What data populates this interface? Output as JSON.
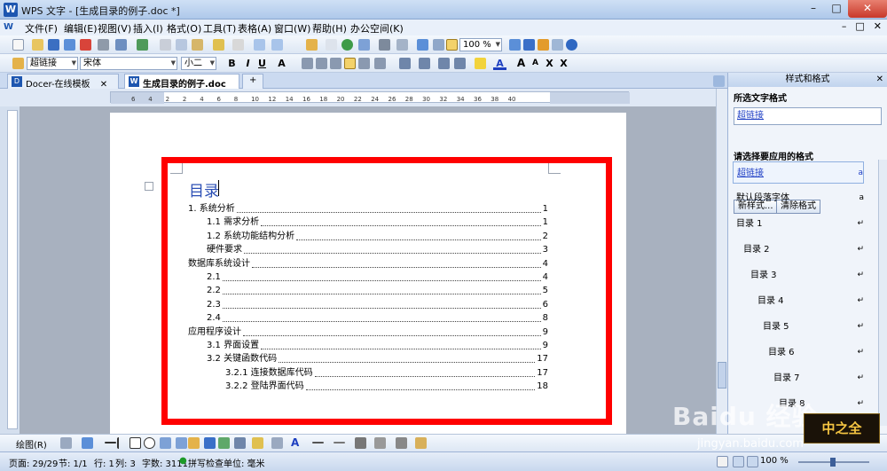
{
  "window": {
    "title": "WPS 文字 - [生成目录的例子.doc *]",
    "app_icon": "W",
    "controls": [
      "–",
      "□",
      "✕"
    ]
  },
  "menu": {
    "items": [
      "文件(F)",
      "编辑(E)",
      "视图(V)",
      "插入(I)",
      "格式(O)",
      "工具(T)",
      "表格(A)",
      "窗口(W)",
      "帮助(H)",
      "办公空间(K)"
    ],
    "mdi_controls": [
      "–",
      "□",
      "✕"
    ]
  },
  "toolbar": {
    "zoom": "100 %",
    "style": "超链接",
    "font": "宋体",
    "size": "小二",
    "format_buttons": [
      "B",
      "I",
      "U",
      "A"
    ],
    "script_buttons": [
      "A",
      "A",
      "X",
      "X"
    ]
  },
  "tabs": [
    {
      "label": "Docer-在线模板",
      "close": "✕"
    },
    {
      "label": "生成目录的例子.doc *",
      "close": "✕"
    }
  ],
  "add_tab": "+",
  "ruler_numbers": [
    "6",
    "4",
    "2",
    "2",
    "4",
    "6",
    "8",
    "10",
    "12",
    "14",
    "16",
    "18",
    "20",
    "22",
    "24",
    "26",
    "28",
    "30",
    "32",
    "34",
    "36",
    "38",
    "40"
  ],
  "document": {
    "toc_title": "目录",
    "entries": [
      {
        "text": "1.                          系统分析",
        "page": "1",
        "indent": 0
      },
      {
        "text": "1.1 需求分析",
        "page": "1",
        "indent": 1
      },
      {
        "text": "1.2 系统功能结构分析",
        "page": "2",
        "indent": 1
      },
      {
        "text": "硬件要求",
        "page": "3",
        "indent": 1
      },
      {
        "text": "数据库系统设计",
        "page": "4",
        "indent": 0
      },
      {
        "text": "2.1",
        "page": "4",
        "indent": 1
      },
      {
        "text": "2.2",
        "page": "5",
        "indent": 1
      },
      {
        "text": "2.3",
        "page": "6",
        "indent": 1
      },
      {
        "text": "2.4",
        "page": "8",
        "indent": 1
      },
      {
        "text": "应用程序设计",
        "page": "9",
        "indent": 0
      },
      {
        "text": "3.1 界面设置",
        "page": "9",
        "indent": 1
      },
      {
        "text": "3.2 关键函数代码",
        "page": "17",
        "indent": 1
      },
      {
        "text": "3.2.1 连接数据库代码",
        "page": "17",
        "indent": 2
      },
      {
        "text": "3.2.2 登陆界面代码",
        "page": "18",
        "indent": 2
      }
    ]
  },
  "panel": {
    "title": "样式和格式",
    "selected_label": "所选文字格式",
    "selected_value": "超链接",
    "new_style": "新样式...",
    "clear_format": "清除格式",
    "apply_label": "请选择要应用的格式",
    "styles": [
      {
        "name": "超链接",
        "mark": "a"
      },
      {
        "name": "默认段落字体",
        "mark": "a"
      },
      {
        "name": "目录 1",
        "mark": "↵"
      },
      {
        "name": "目录 2",
        "mark": "↵"
      },
      {
        "name": "目录 3",
        "mark": "↵"
      },
      {
        "name": "目录 4",
        "mark": "↵"
      },
      {
        "name": "目录 5",
        "mark": "↵"
      },
      {
        "name": "目录 6",
        "mark": "↵"
      },
      {
        "name": "目录 7",
        "mark": "↵"
      },
      {
        "name": "目录 8",
        "mark": "↵"
      }
    ]
  },
  "drawbar": {
    "label": "绘图(R)"
  },
  "status": {
    "page": "页面: 29/29",
    "section": "节: 1/1",
    "row": "行: 1",
    "col": "列: 3",
    "words": "字数: 3111",
    "spell": "拼写检查",
    "unit": "单位: 毫米",
    "zoom": "100 %"
  },
  "watermark": {
    "brand": "Baidu 经验",
    "url": "jingyan.baidu.com",
    "logo": "中之全"
  },
  "colors": {
    "toc_title": "#2b4fb5",
    "highlight_box": "#ff0000",
    "link": "#1f3fc5"
  }
}
